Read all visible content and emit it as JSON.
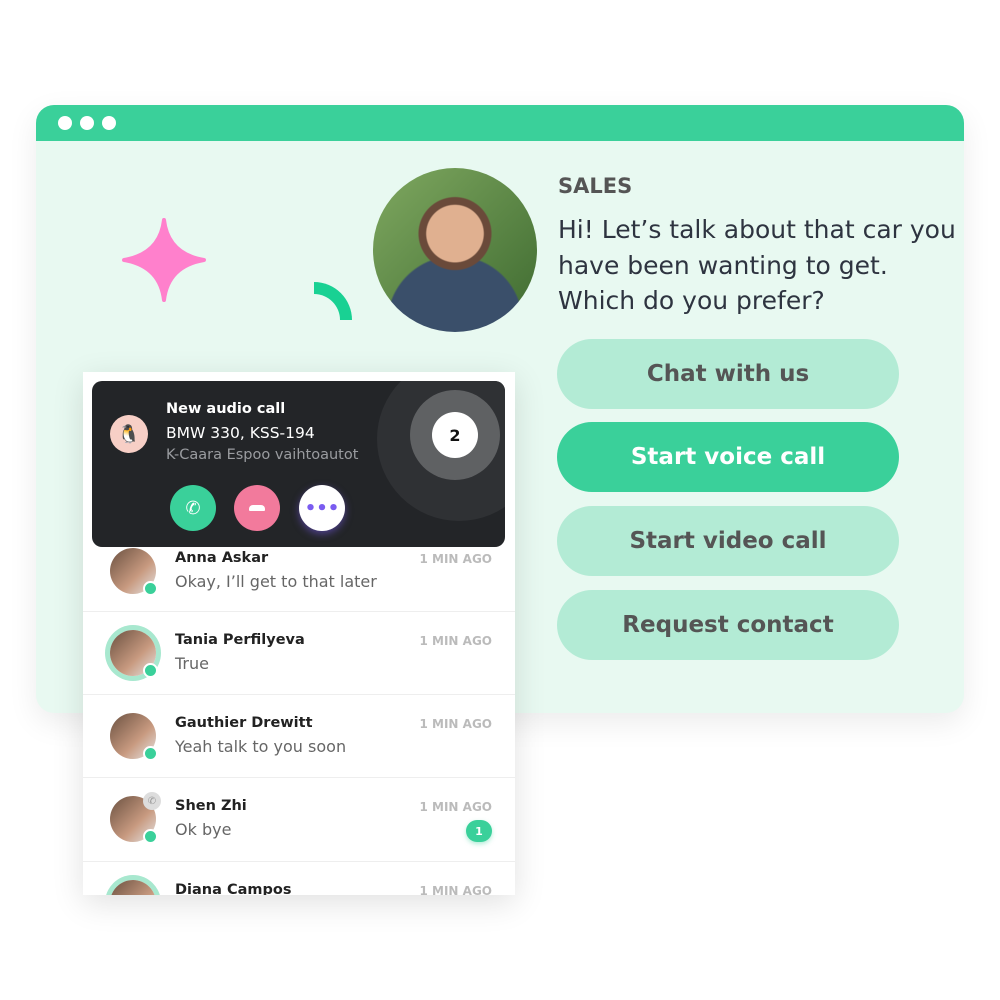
{
  "colors": {
    "accent": "#3ad09a",
    "background": "#e8f9f1",
    "button_light": "#b3ebd5",
    "decline": "#f27a9c",
    "sparkle": "#ff80cc"
  },
  "agent": {
    "department": "SALES",
    "message": "Hi! Let’s talk about that car you have been wanting to get. Which do you prefer?"
  },
  "options": [
    {
      "label": "Chat with us",
      "active": false
    },
    {
      "label": "Start voice call",
      "active": true
    },
    {
      "label": "Start video call",
      "active": false
    },
    {
      "label": "Request contact",
      "active": false
    }
  ],
  "call": {
    "title": "New audio call",
    "subject": "BMW 330, KSS-194",
    "dealer": "K-Caara Espoo vaihtoautot",
    "queue_count": "2",
    "accept_icon": "phone-icon",
    "decline_icon": "hangup-icon",
    "more_icon": "more-icon"
  },
  "conversations": [
    {
      "name": "Anna Askar",
      "message": "Okay, I’ll get to that later",
      "time": "1 MIN AGO"
    },
    {
      "name": "Tania Perfilyeva",
      "message": "True",
      "time": "1 MIN AGO"
    },
    {
      "name": "Gauthier Drewitt",
      "message": "Yeah talk to you soon",
      "time": "1 MIN AGO"
    },
    {
      "name": "Shen Zhi",
      "message": "Ok bye",
      "time": "1 MIN AGO",
      "unread": "1"
    },
    {
      "name": "Diana Campos",
      "message": "",
      "time": "1 MIN AGO"
    }
  ]
}
